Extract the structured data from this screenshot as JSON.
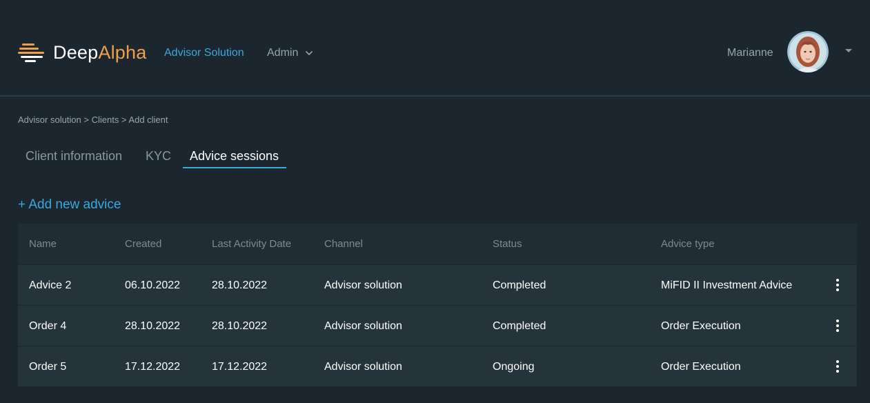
{
  "brand": {
    "name_part1": "Deep",
    "name_part2": "Alpha",
    "accent": "#f0a04a",
    "logo_icon": "stacked-stripes-logo"
  },
  "nav": {
    "solution_label": "Advisor Solution",
    "admin_label": "Admin"
  },
  "user": {
    "name": "Marianne",
    "avatar": "user-avatar-photo"
  },
  "breadcrumb": "Advisor solution > Clients > Add client",
  "tabs": [
    {
      "label": "Client information",
      "active": false
    },
    {
      "label": "KYC",
      "active": false
    },
    {
      "label": "Advice sessions",
      "active": true
    }
  ],
  "actions": {
    "add_advice": "+ Add new advice"
  },
  "table": {
    "columns": [
      "Name",
      "Created",
      "Last Activity Date",
      "Channel",
      "Status",
      "Advice type"
    ],
    "rows": [
      [
        "Advice 2",
        "06.10.2022",
        "28.10.2022",
        "Advisor solution",
        "Completed",
        "MiFID II Investment Advice"
      ],
      [
        "Order 4",
        "28.10.2022",
        "28.10.2022",
        "Advisor solution",
        "Completed",
        "Order Execution"
      ],
      [
        "Order 5",
        "17.12.2022",
        "17.12.2022",
        "Advisor solution",
        "Ongoing",
        "Order Execution"
      ]
    ]
  },
  "colors": {
    "background": "#1b262e",
    "primary": "#3aa9e0",
    "table_row": "#25333b",
    "table_header": "#202d35"
  }
}
